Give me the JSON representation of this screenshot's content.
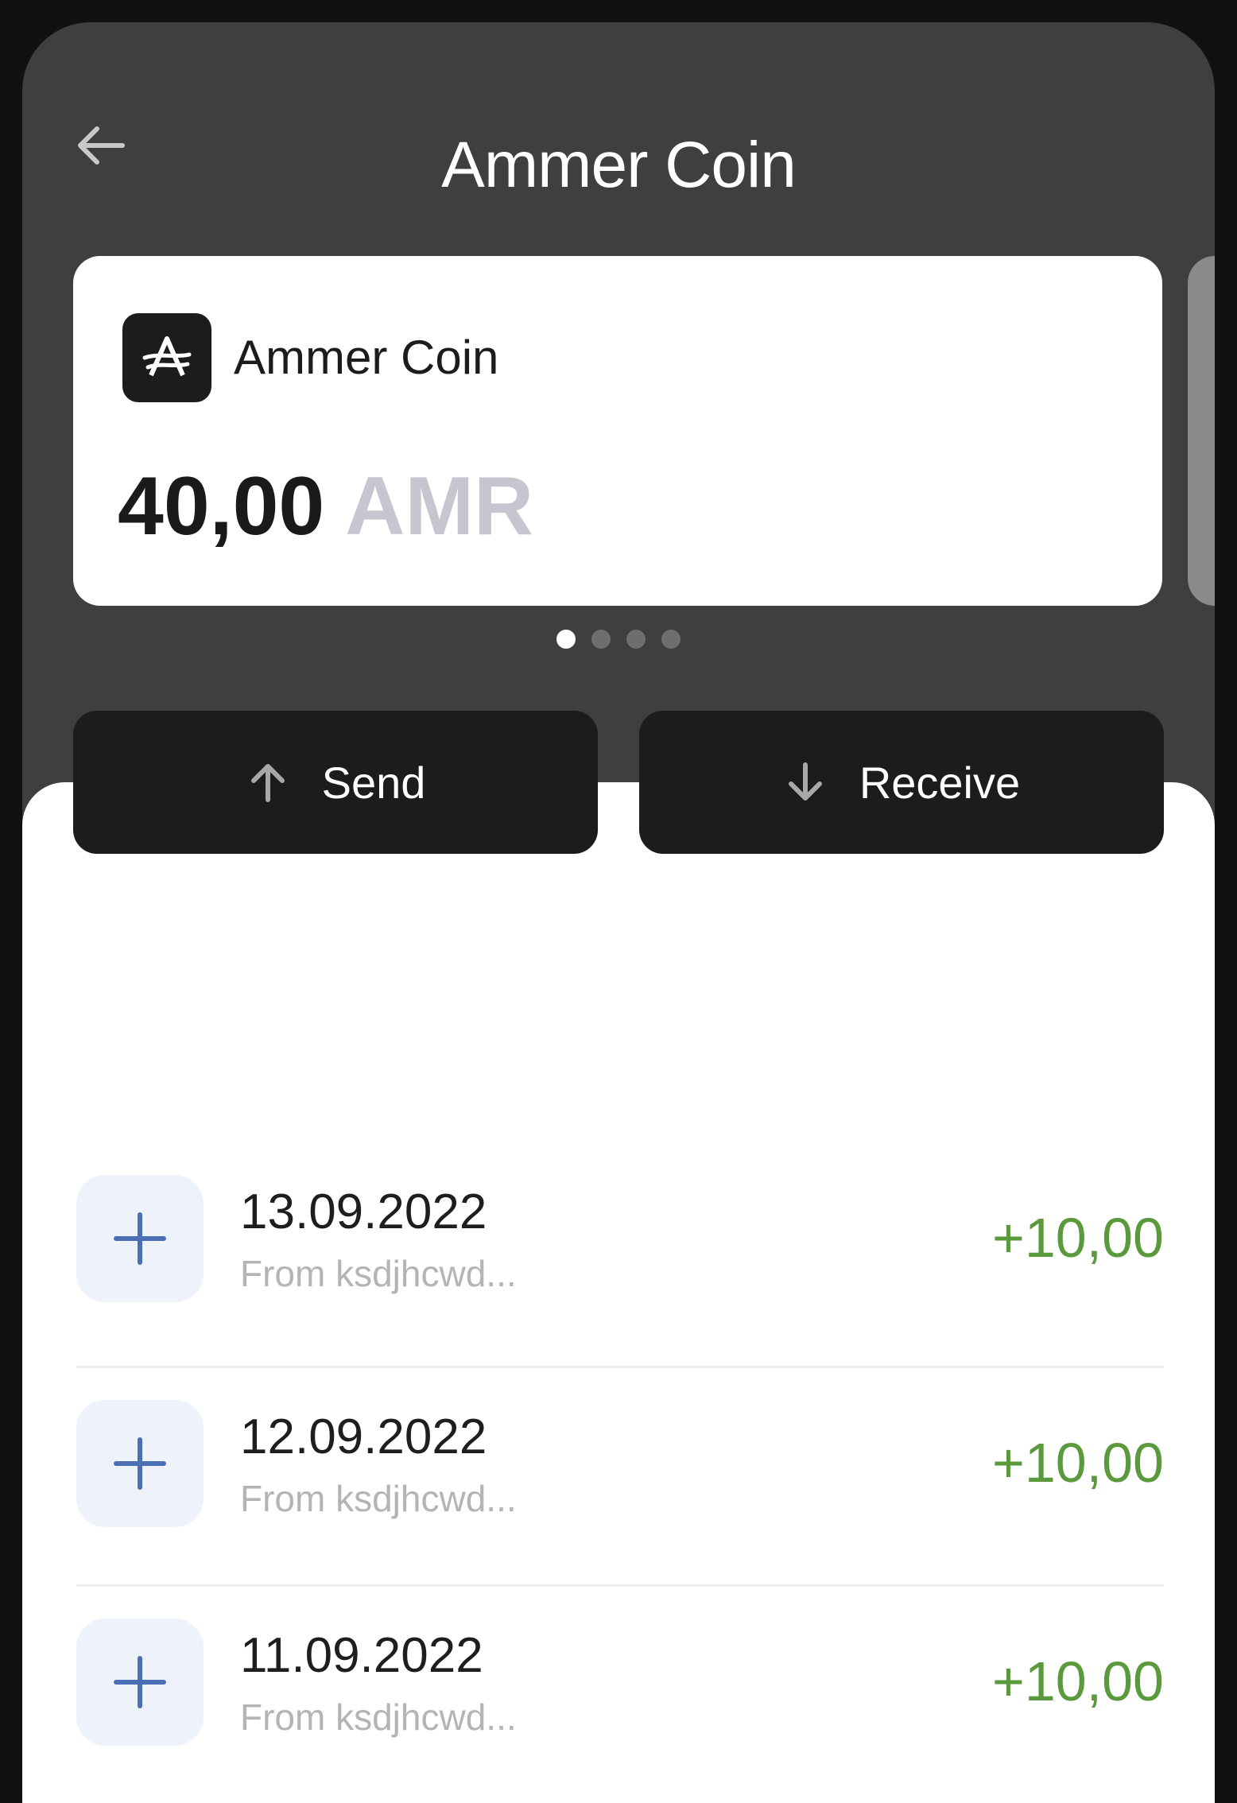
{
  "header": {
    "title": "Ammer Coin",
    "back_icon": "arrow-left-icon"
  },
  "card": {
    "coin_name": "Ammer Coin",
    "logo_icon": "ammer-logo-icon",
    "balance": "40,00",
    "currency": "AMR"
  },
  "pager": {
    "count": 4,
    "active_index": 0
  },
  "actions": {
    "send_label": "Send",
    "send_icon": "arrow-up-icon",
    "receive_label": "Receive",
    "receive_icon": "arrow-down-icon"
  },
  "transactions": [
    {
      "date": "13.09.2022",
      "from": "From ksdjhcwd...",
      "amount": "+10,00",
      "icon": "plus-icon"
    },
    {
      "date": "12.09.2022",
      "from": "From ksdjhcwd...",
      "amount": "+10,00",
      "icon": "plus-icon"
    },
    {
      "date": "11.09.2022",
      "from": "From ksdjhcwd...",
      "amount": "+10,00",
      "icon": "plus-icon"
    }
  ],
  "colors": {
    "background": "#3f3f3f",
    "button": "#1c1c1c",
    "positive_amount": "#5a9a3c",
    "plus_icon": "#4a6fb5",
    "currency_muted": "#c7c5d0"
  }
}
